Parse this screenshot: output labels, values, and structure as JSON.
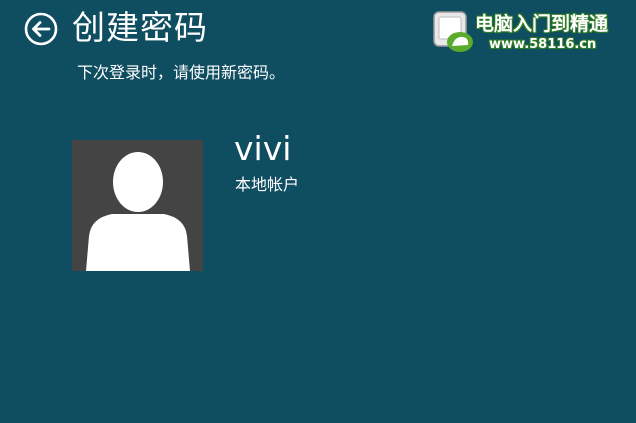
{
  "header": {
    "back_icon": "back-arrow-circle-icon",
    "title": "创建密码",
    "subtitle": "下次登录时，请使用新密码。"
  },
  "account": {
    "avatar_icon": "default-user-avatar-icon",
    "name": "vivi",
    "type": "本地帐户"
  },
  "watermark": {
    "logo_icon": "site-logo-icon",
    "title": "电脑入门到精通",
    "url": "www.58116.cn"
  },
  "colors": {
    "background": "#0f4d61",
    "avatar_background": "#444444",
    "text": "#ffffff",
    "watermark_accent": "#2d7a24"
  }
}
